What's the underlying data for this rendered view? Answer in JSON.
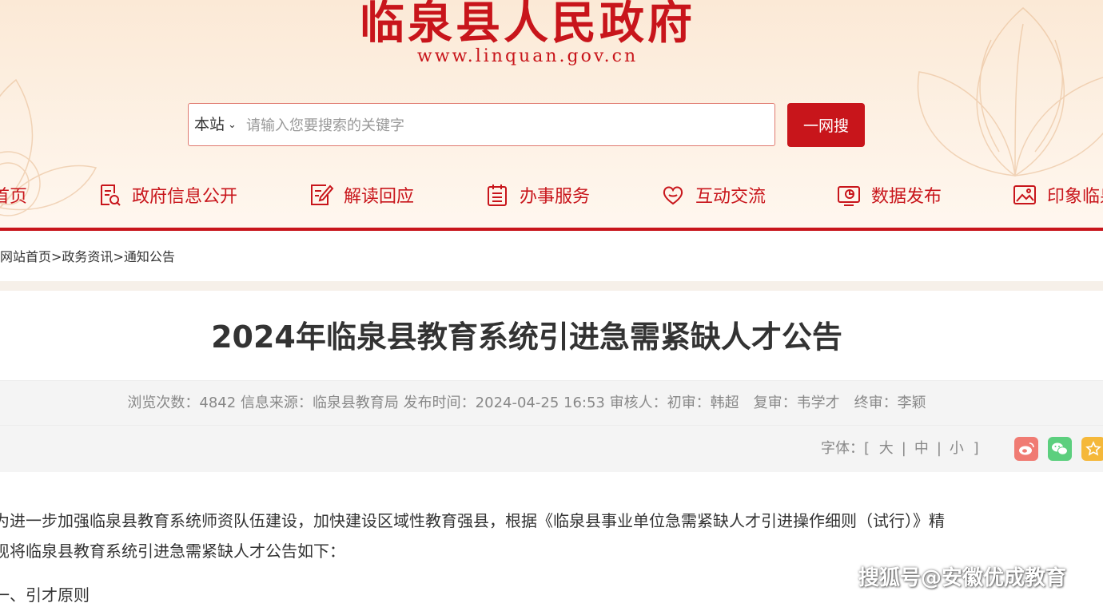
{
  "header": {
    "site_title": "临泉县人民政府",
    "site_url": "www.linquan.gov.cn",
    "search": {
      "scope": "本站",
      "placeholder": "请输入您要搜索的关键字",
      "button": "一网搜"
    },
    "nav": [
      {
        "label": "首页",
        "icon": "home-icon"
      },
      {
        "label": "政府信息公开",
        "icon": "document-icon"
      },
      {
        "label": "解读回应",
        "icon": "edit-icon"
      },
      {
        "label": "办事服务",
        "icon": "calendar-icon"
      },
      {
        "label": "互动交流",
        "icon": "heart-chat-icon"
      },
      {
        "label": "数据发布",
        "icon": "chart-screen-icon"
      },
      {
        "label": "印象临泉",
        "icon": "image-icon"
      }
    ],
    "accent_color": "#c8151b"
  },
  "breadcrumb": {
    "items": [
      "网站首页",
      "政务资讯",
      "通知公告"
    ],
    "separator": ">"
  },
  "article": {
    "title": "2024年临泉县教育系统引进急需紧缺人才公告",
    "meta": {
      "views_label": "浏览次数：",
      "views": "4842",
      "source_label": "信息来源：",
      "source": "临泉县教育局",
      "date_label": "发布时间：",
      "date": "2024-04-25 16:53",
      "reviewer_label": "审核人：",
      "first_review": "初审：韩超",
      "second_review": "复审：韦学才",
      "final_review": "终审：李颖"
    },
    "font_size": {
      "label": "字体：",
      "open": "[",
      "large": "大",
      "medium": "中",
      "small": "小",
      "close": "]",
      "divider": "|"
    },
    "share": [
      "weibo-icon",
      "wechat-icon",
      "favorite-icon"
    ],
    "paragraph_1": "为进一步加强临泉县教育系统师资队伍建设，加快建设区域性教育强县，根据《临泉县事业单位急需紧缺人才引进操作细则（试行）》精",
    "paragraph_2": "现将临泉县教育系统引进急需紧缺人才公告如下：",
    "section_1": "一、引才原则"
  },
  "watermark": "搜狐号@安徽优成教育"
}
